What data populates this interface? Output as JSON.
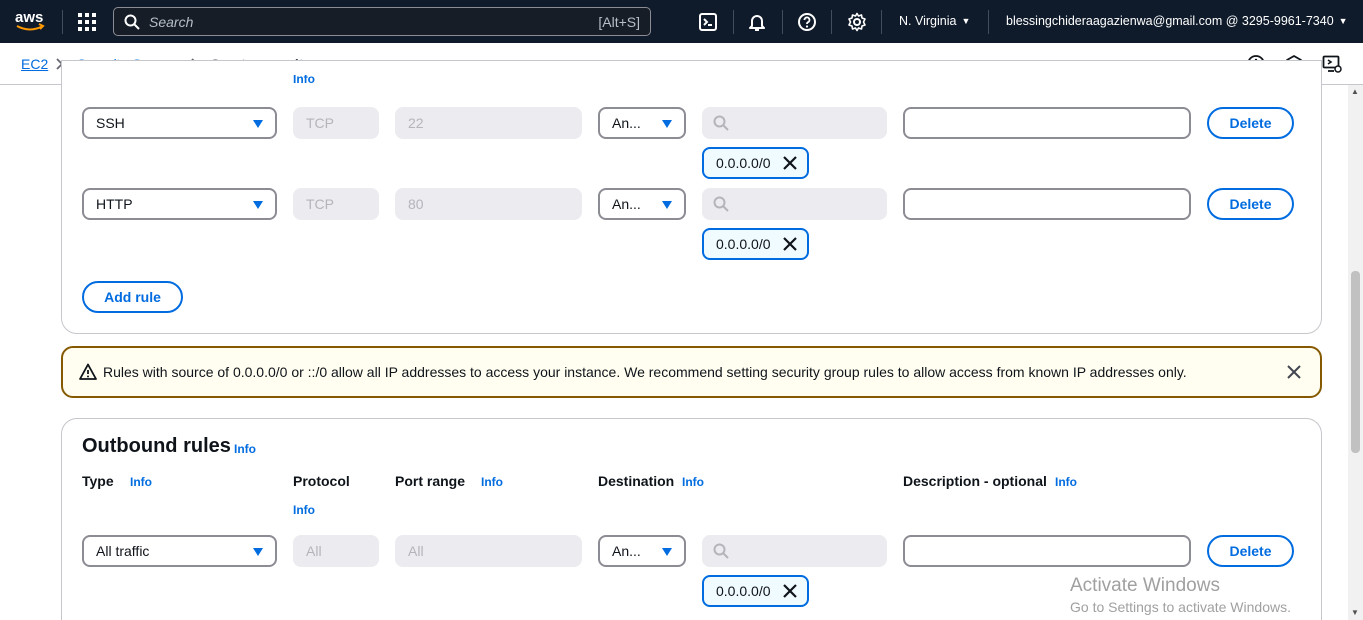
{
  "topnav": {
    "logo_text": "aws",
    "search_placeholder": "Search",
    "search_shortcut": "[Alt+S]",
    "region": "N. Virginia",
    "account": "blessingchideraagazienwa@gmail.com @ 3295-9961-7340",
    "icons": [
      "cloudshell-icon",
      "bell-icon",
      "help-icon",
      "gear-icon"
    ]
  },
  "breadcrumb": {
    "items": [
      "EC2",
      "Security Groups",
      "Create security group"
    ]
  },
  "inbound": {
    "partial_info": "Info",
    "rules": [
      {
        "type": "SSH",
        "protocol": "TCP",
        "port": "22",
        "source_type": "An...",
        "cidr": "0.0.0.0/0",
        "delete_label": "Delete"
      },
      {
        "type": "HTTP",
        "protocol": "TCP",
        "port": "80",
        "source_type": "An...",
        "cidr": "0.0.0.0/0",
        "delete_label": "Delete"
      }
    ],
    "add_rule_label": "Add rule"
  },
  "warning": {
    "text": "Rules with source of 0.0.0.0/0 or ::/0 allow all IP addresses to access your instance. We recommend setting security group rules to allow access from known IP addresses only."
  },
  "outbound": {
    "title": "Outbound rules",
    "title_info": "Info",
    "columns": {
      "type": "Type",
      "protocol": "Protocol",
      "port_range": "Port range",
      "destination": "Destination",
      "description": "Description - optional"
    },
    "info_label": "Info",
    "rules": [
      {
        "type": "All traffic",
        "protocol": "All",
        "port": "All",
        "dest_type": "An...",
        "cidr": "0.0.0.0/0",
        "delete_label": "Delete"
      }
    ]
  },
  "watermark": {
    "line1": "Activate Windows",
    "line2": "Go to Settings to activate Windows."
  },
  "colors": {
    "nav_bg": "#0f1b2a",
    "link": "#006ce0",
    "warning_border": "#855900",
    "warning_bg": "#fffef0"
  }
}
